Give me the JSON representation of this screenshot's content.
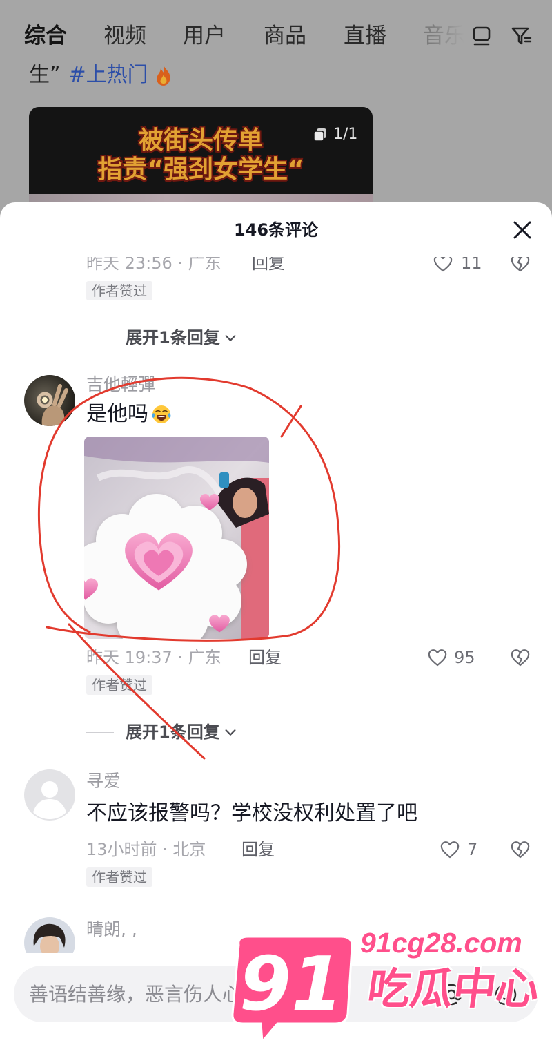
{
  "top_bar": {
    "tabs": [
      {
        "label": "综合",
        "active": true
      },
      {
        "label": "视频"
      },
      {
        "label": "用户"
      },
      {
        "label": "商品"
      },
      {
        "label": "直播"
      },
      {
        "label": "音乐"
      }
    ],
    "icons": [
      "layout-icon",
      "filter-icon"
    ]
  },
  "video_result": {
    "caption_prefix": "生”",
    "hashtag": "#上热门",
    "hashtag_icon": "fire-icon",
    "thumbnail": {
      "line1": "被街头传单",
      "line2": "指责“强刭女学生“",
      "badge": "1/1",
      "badge_icon": "image-stack-icon"
    }
  },
  "comments_panel": {
    "title": "146条评论",
    "close_icon": "close-icon",
    "comments": [
      {
        "time_location": "昨天 23:56 · 广东",
        "reply_label": "回复",
        "likes": "11",
        "author_liked": "作者赞过",
        "expand_replies": "展开1条回复"
      },
      {
        "username": "吉他輕彈",
        "text": "是他吗",
        "emoji_icon": "face-with-tears-of-joy-icon",
        "has_image": true,
        "time_location": "昨天 19:37 · 广东",
        "reply_label": "回复",
        "likes": "95",
        "author_liked": "作者赞过",
        "expand_replies": "展开1条回复"
      },
      {
        "username": "寻爱",
        "text": "不应该报警吗？学校没权利处置了吧",
        "time_location": "13小时前 · 北京",
        "reply_label": "回复",
        "likes": "7",
        "author_liked": "作者赞过"
      },
      {
        "username": "晴朗, ,"
      }
    ]
  },
  "comment_input": {
    "placeholder": "善语结善缘，恶言伤人心",
    "icons": [
      "at-mention-icon",
      "emoji-icon"
    ]
  },
  "watermark": {
    "logo_text": "91",
    "domain": "91cg28.com",
    "name": "吃瓜中心"
  },
  "colors": {
    "overlay": "#a6a6a6",
    "hashtag": "#2c4ea8",
    "annotation_red": "#e23a2e",
    "watermark_pink": "#ff4f8b"
  }
}
